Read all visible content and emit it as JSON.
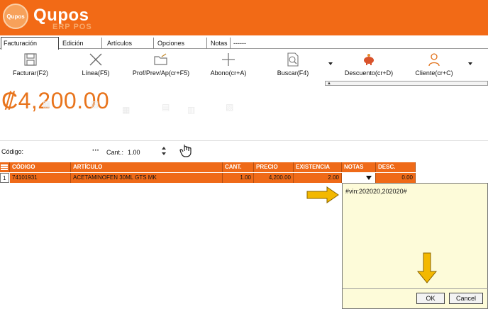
{
  "app": {
    "logo_badge": "Qupos",
    "logo_name": "Qupos",
    "logo_sub": "ERP POS",
    "brand_color": "#f26a16"
  },
  "menu": {
    "tabs": [
      "Facturación",
      "Edición",
      "Artículos",
      "Opciones",
      "Notas",
      "------"
    ]
  },
  "toolbar": {
    "facturar": "Facturar(F2)",
    "linea": "Línea(F5)",
    "prof": "Prof/Prev/Ap(cr+F5)",
    "abono": "Abono(cr+A)",
    "buscar": "Buscar(F4)",
    "descuento": "Descuento(cr+D)",
    "cliente": "Cliente(cr+C)"
  },
  "amount": "₡4,200.00",
  "entry": {
    "code_label": "Código:",
    "dots": "···",
    "cant_label": "Cant.:",
    "cant_value": "1.00"
  },
  "table": {
    "headers": [
      "CÓDIGO",
      "ARTÍCULO",
      "CANT.",
      "PRECIO",
      "EXISTENCIA",
      "NOTAS",
      "DESC."
    ],
    "row": {
      "num": "1",
      "codigo": "74101931",
      "articulo": "ACETAMINOFEN 30ML GTS MK",
      "cant": "1.00",
      "precio": "4,200.00",
      "existencia": "2.00",
      "desc": "0.00"
    }
  },
  "notes_popup": {
    "text": "#vin:202020,202020#",
    "ok": "OK",
    "cancel": "Cancel"
  },
  "annotations": {
    "arrow_color": "#f3b800"
  }
}
